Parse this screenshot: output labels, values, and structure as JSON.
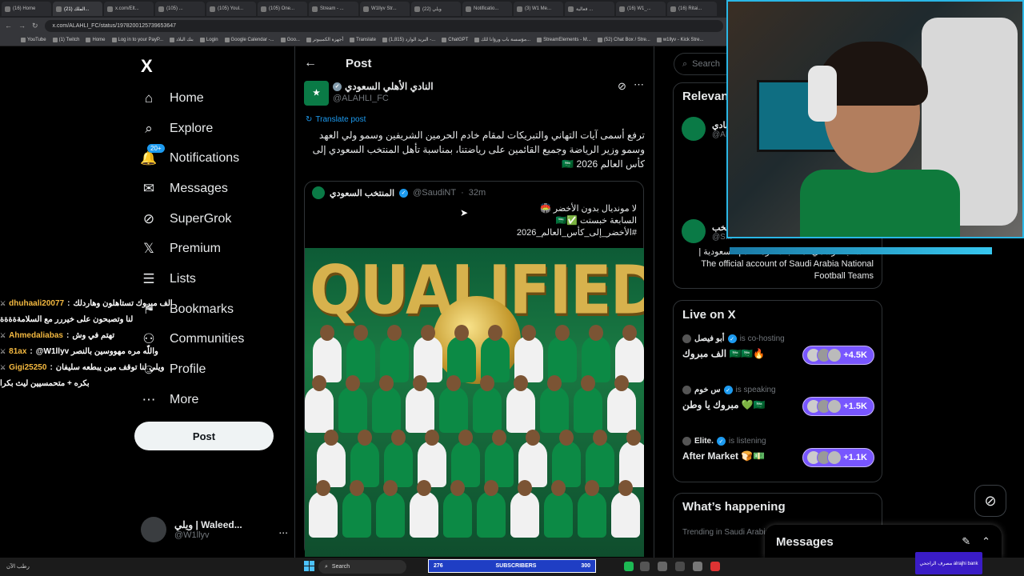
{
  "browser": {
    "tabs": [
      "(16) Home",
      "(21) الملك...",
      "x.com/Elt...",
      "(105) ...",
      "(105) Youl...",
      "(105) One...",
      "Stream - ...",
      "W1llyv Str...",
      "(22) ويلي",
      "Notificatio...",
      "(3) W1 Me...",
      "فعالية ...",
      "(16) W1_...",
      "(16) Ritai..."
    ],
    "active_tab": 1,
    "url": "x.com/ALAHLI_FC/status/1978200125739653647",
    "bookmarks": [
      "YouTube",
      "(1) Twitch",
      "Home",
      "Log in to your PayP...",
      "بنك البلاد",
      "Login",
      "Google Calendar -...",
      "Goo...",
      "أجهزة الكمبيوتر",
      "Translate",
      "(1,815) البريد الوارد -...",
      "ChatGPT",
      "مؤسسة باب ورؤانا للك...",
      "StreamElements - M...",
      "(52) Chat Box / Stre...",
      "w1llyv - Kick Stre..."
    ]
  },
  "nav": {
    "logo": "X",
    "items": [
      {
        "label": "Home",
        "icon": "⌂"
      },
      {
        "label": "Explore",
        "icon": "⌕"
      },
      {
        "label": "Notifications",
        "icon": "🔔",
        "badge": "20+"
      },
      {
        "label": "Messages",
        "icon": "✉"
      },
      {
        "label": "SuperGrok",
        "icon": "⊘"
      },
      {
        "label": "Premium",
        "icon": "𝕏"
      },
      {
        "label": "Lists",
        "icon": "☰"
      },
      {
        "label": "Bookmarks",
        "icon": "⚑"
      },
      {
        "label": "Communities",
        "icon": "⚇"
      },
      {
        "label": "Profile",
        "icon": "☺"
      },
      {
        "label": "More",
        "icon": "⋯"
      }
    ],
    "post_button": "Post",
    "account": {
      "name": "ويلي | Waleed...",
      "handle": "@W1llyv",
      "more": "..."
    }
  },
  "chat": [
    {
      "user": "dhuhaali20077",
      "msg": "الف مبروك تستاهلون وهاردلك"
    },
    {
      "user": "",
      "msg": "لنا وتصبحون على خيررر مع السلامةةةةة"
    },
    {
      "user": "Ahmedaliabas",
      "msg": "تهتم في وش"
    },
    {
      "user": "81ax",
      "msg": "@W1llyv واللّه مره مهووسين بالنصر"
    },
    {
      "user": "Gigi25250",
      "msg": "ويلي لنا توقف مين يبطعه سليفان"
    },
    {
      "user": "",
      "msg": "بكره + متحمسيين ليث بكرا"
    }
  ],
  "post": {
    "header_title": "Post",
    "author_name": "النادي الأهلي السعودي",
    "author_handle": "@ALAHLI_FC",
    "translate": "Translate post",
    "text": "ترفع أسمى آيات التهاني والتبريكات لمقام خادم الحرمين الشريفين وسمو ولي العهد وسمو وزير الرياضة وجميع القائمين على رياضتنا، بمناسبة تأهل المنتخب السعودي إلى كأس العالم 2026 🇸🇦",
    "quote": {
      "name": "المنتخب السعودي",
      "handle": "@SaudiNT",
      "time": "32m",
      "lines": [
        "لا مونديال بدون الأخضر 🏟️",
        "السابعة خبستت ✅🇸🇦",
        "#الأخضر_إلى_كأس_العالم_2026"
      ],
      "image_word": "QUALIFIED"
    }
  },
  "right": {
    "search_placeholder": "Search",
    "relevant_title": "Relevant people",
    "relevant": [
      {
        "name": "النادي...",
        "handle": "@AL..."
      },
      {
        "name": "المنتخب...",
        "handle": "@S..."
      }
    ],
    "relevant_bio": "الحساب الرسمي لمنتخبات كرة القدم السعودية | The official account of Saudi Arabia National Football Teams",
    "live_title": "Live on X",
    "live": [
      {
        "host": "أبو فيصل",
        "status": "is co-hosting",
        "topic": "الف مبروك 🇸🇦🇸🇦🔥",
        "count": "+4.5K"
      },
      {
        "host": "س خوم",
        "status": "is speaking",
        "topic": "مبروك يا وطن 💚🇸🇦",
        "count": "+1.5K"
      },
      {
        "host": "Elite.",
        "status": "is listening",
        "topic": "After Market 🍞💵",
        "count": "+1.1K"
      }
    ],
    "happening_title": "What’s happening",
    "trending": "Trending in Saudi Arabia",
    "messages_title": "Messages"
  },
  "taskbar": {
    "weather": "رطب الآن",
    "search": "Search",
    "subs_current": "276",
    "subs_label": "SUBSCRIBERS",
    "subs_goal": "300",
    "bank": "مصرف الراجحي alrajhi bank"
  },
  "colors": {
    "accent": "#1d9bf0",
    "spaces": "#7856ff",
    "gold": "#d7b24d",
    "green": "#0a7a46"
  }
}
